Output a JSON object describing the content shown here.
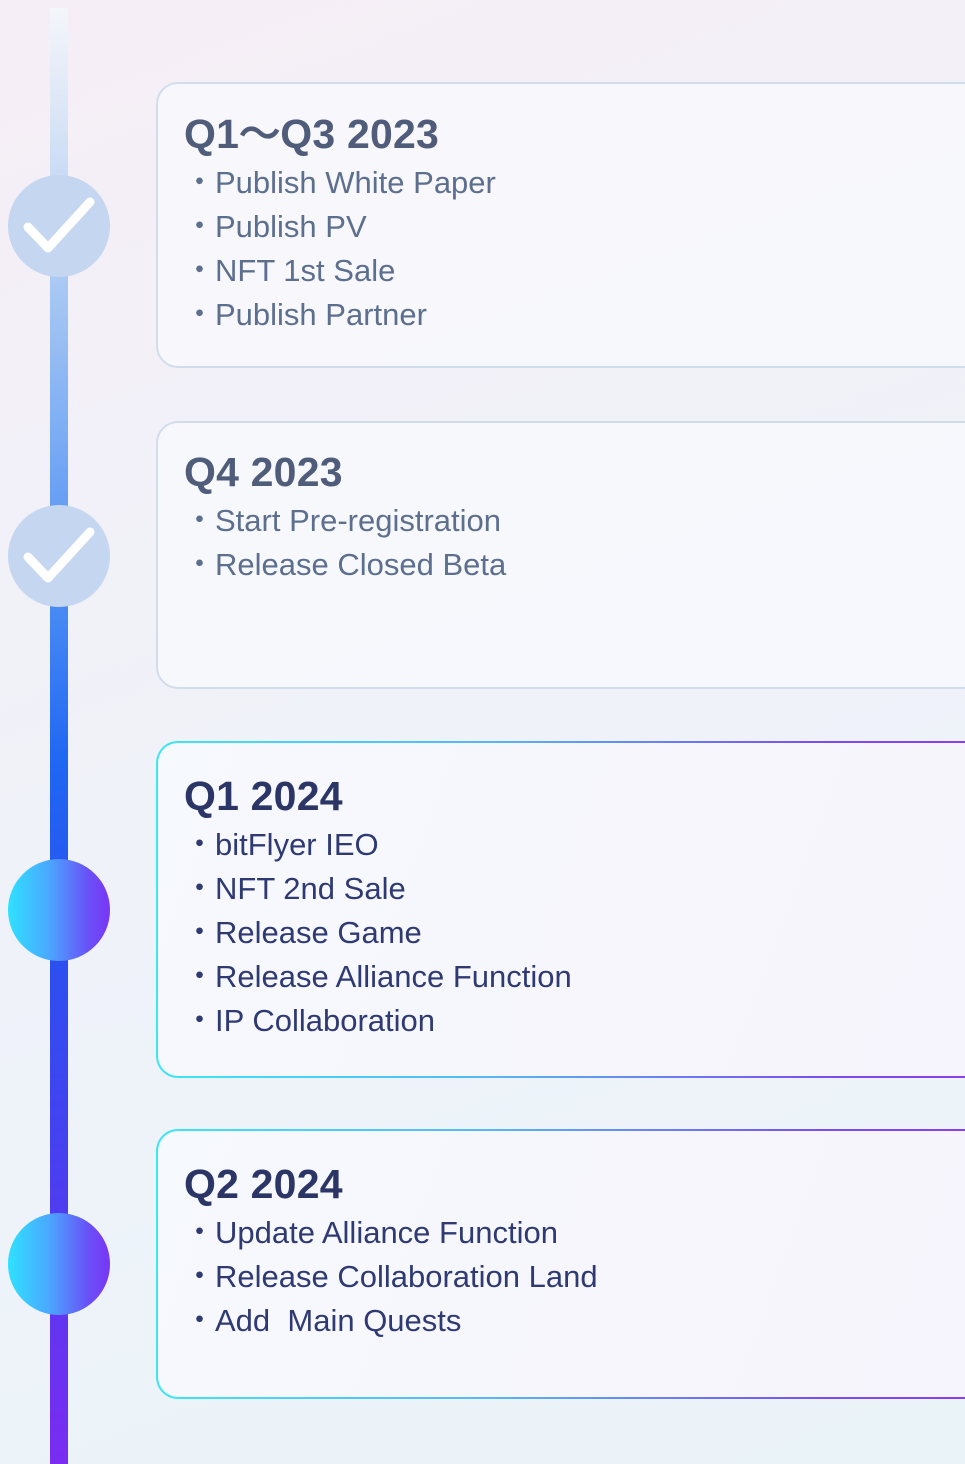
{
  "roadmap": {
    "phases": [
      {
        "title": "Q1～Q3 2023",
        "status": "done",
        "items": [
          "Publish White Paper",
          "Publish PV",
          "NFT 1st Sale",
          "Publish Partner"
        ]
      },
      {
        "title": "Q4 2023",
        "status": "done",
        "items": [
          "Start Pre-registration",
          "Release Closed Beta"
        ]
      },
      {
        "title": "Q1 2024",
        "status": "active",
        "items": [
          "bitFlyer IEO",
          "NFT 2nd Sale",
          "Release Game",
          "Release Alliance Function",
          "IP Collaboration"
        ]
      },
      {
        "title": "Q2 2024",
        "status": "active",
        "items": [
          "Update Alliance Function",
          "Release Collaboration Land",
          "Add  Main Quests"
        ]
      }
    ]
  },
  "icons": {
    "done": "checkmark-icon"
  },
  "colors": {
    "done_node": "#c4d6f0",
    "active_gradient_start": "#2fe1ff",
    "active_gradient_end": "#7a36f4",
    "title_done": "#4f5d7a",
    "title_active": "#2b3566"
  }
}
